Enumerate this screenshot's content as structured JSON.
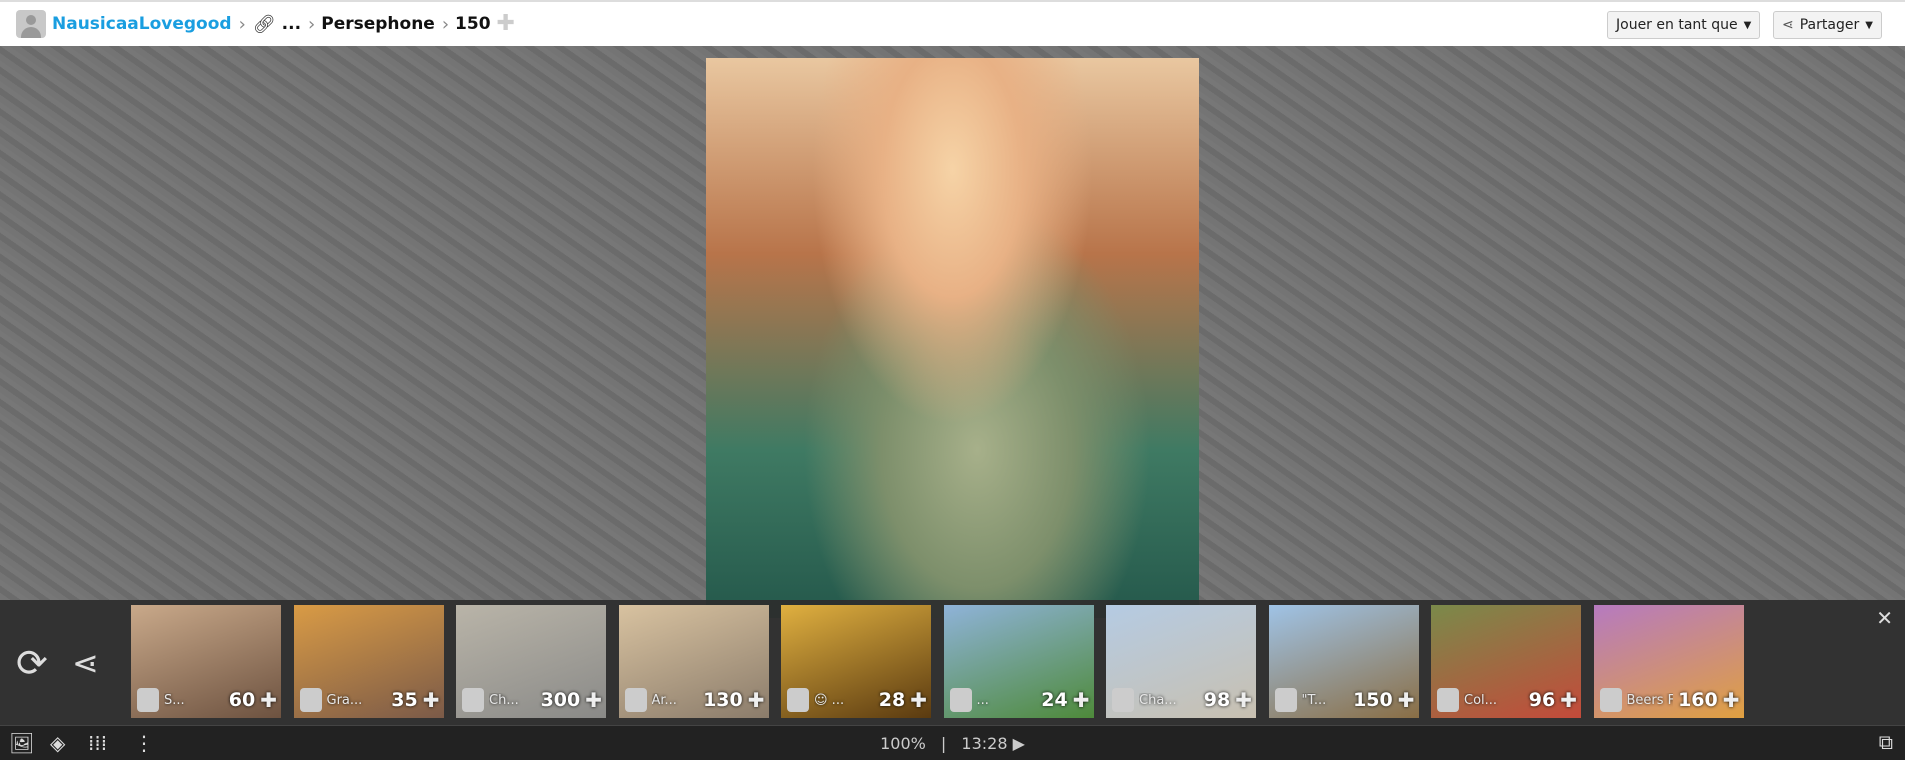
{
  "header": {
    "user": "NausicaaLovegood",
    "ellipsis": "...",
    "puzzle_name": "Persephone",
    "piece_count": "150",
    "play_as": "Jouer en tant que",
    "share": "Partager"
  },
  "thumbnails": [
    {
      "title": "S...",
      "count": "60",
      "colors": [
        "#c9a98a",
        "#6d5240"
      ]
    },
    {
      "title": "Gra...",
      "count": "35",
      "colors": [
        "#d99b45",
        "#7b5a48"
      ]
    },
    {
      "title": "Ch...",
      "count": "300",
      "colors": [
        "#b9b4a8",
        "#8a8a88"
      ]
    },
    {
      "title": "Ar...",
      "count": "130",
      "colors": [
        "#d8c2a0",
        "#8b7c6b"
      ]
    },
    {
      "title": "☺ ...",
      "count": "28",
      "colors": [
        "#e0b040",
        "#5a3a10"
      ]
    },
    {
      "title": "...",
      "count": "24",
      "colors": [
        "#8fb3d9",
        "#4e8a3a"
      ]
    },
    {
      "title": "Cha...",
      "count": "98",
      "colors": [
        "#b5cbe3",
        "#c8c0b0"
      ]
    },
    {
      "title": "\"T...",
      "count": "150",
      "colors": [
        "#9fc3e6",
        "#8a6e45"
      ]
    },
    {
      "title": "Col...",
      "count": "96",
      "colors": [
        "#7a8a4a",
        "#c44a3a"
      ]
    },
    {
      "title": "Beers F...",
      "count": "160",
      "colors": [
        "#b67ac0",
        "#e0a040"
      ]
    }
  ],
  "status": {
    "zoom": "100%",
    "separator": "|",
    "time": "13:28"
  }
}
